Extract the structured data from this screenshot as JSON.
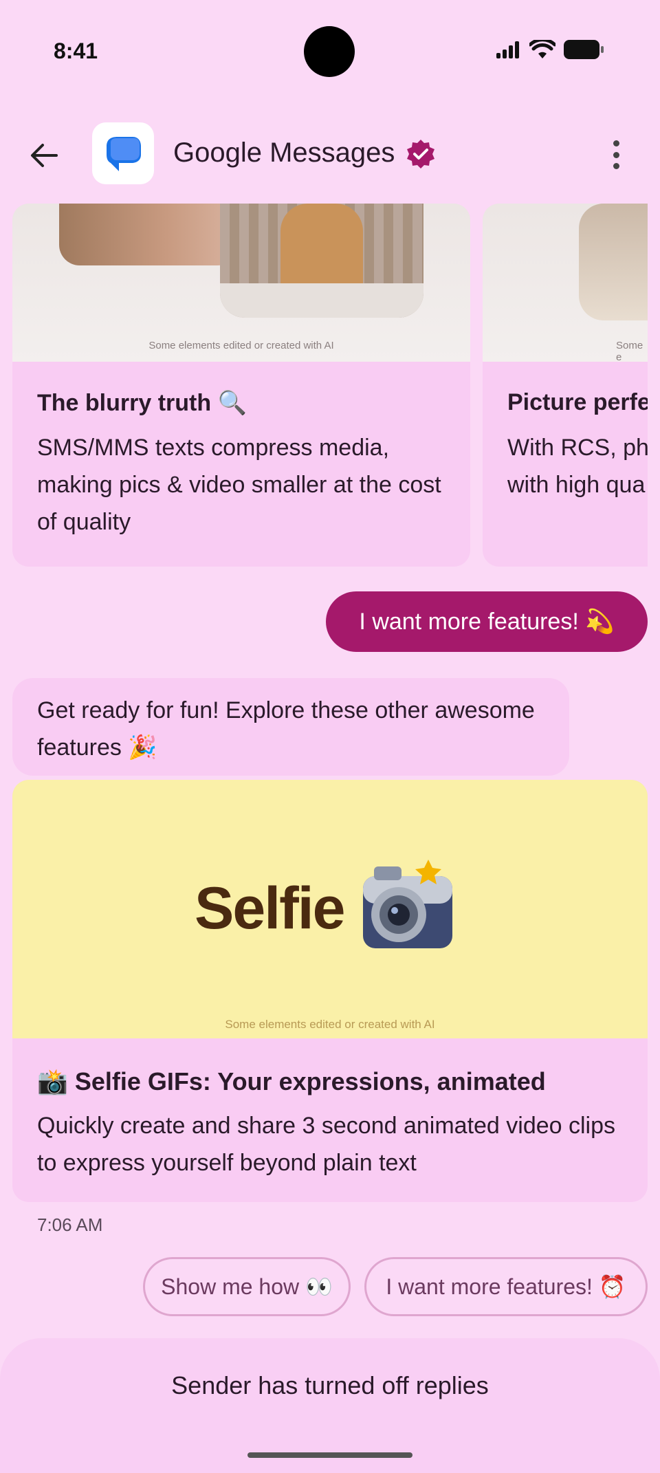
{
  "status_bar": {
    "time": "8:41"
  },
  "header": {
    "title": "Google Messages"
  },
  "carousel": [
    {
      "ai_note": "Some elements edited or created with AI",
      "title": "The blurry truth 🔍",
      "body": "SMS/MMS texts compress media, making pics & video smaller at the cost of quality"
    },
    {
      "ai_note": "Some e",
      "title": "Picture perfe",
      "body_line1": "With RCS, ph",
      "body_line2": "with high qua"
    }
  ],
  "outgoing_message": "I want more features! 💫",
  "incoming_message": "Get ready for fun! Explore these other awesome features 🎉",
  "selfie_card": {
    "image_word": "Selfie",
    "ai_note": "Some elements edited or created with AI",
    "title": "📸 Selfie GIFs: Your expressions, animated",
    "body": "Quickly create and share 3 second animated video clips to express yourself beyond plain text"
  },
  "timestamp": "7:06 AM",
  "suggestions": [
    "Show me how 👀",
    "I want more features! ⏰"
  ],
  "footer": {
    "text": "Sender has turned off replies"
  },
  "colors": {
    "background": "#fbd9f6",
    "card": "#f9ccf3",
    "accent": "#a5196b",
    "selfie_bg": "#faf0a8"
  }
}
